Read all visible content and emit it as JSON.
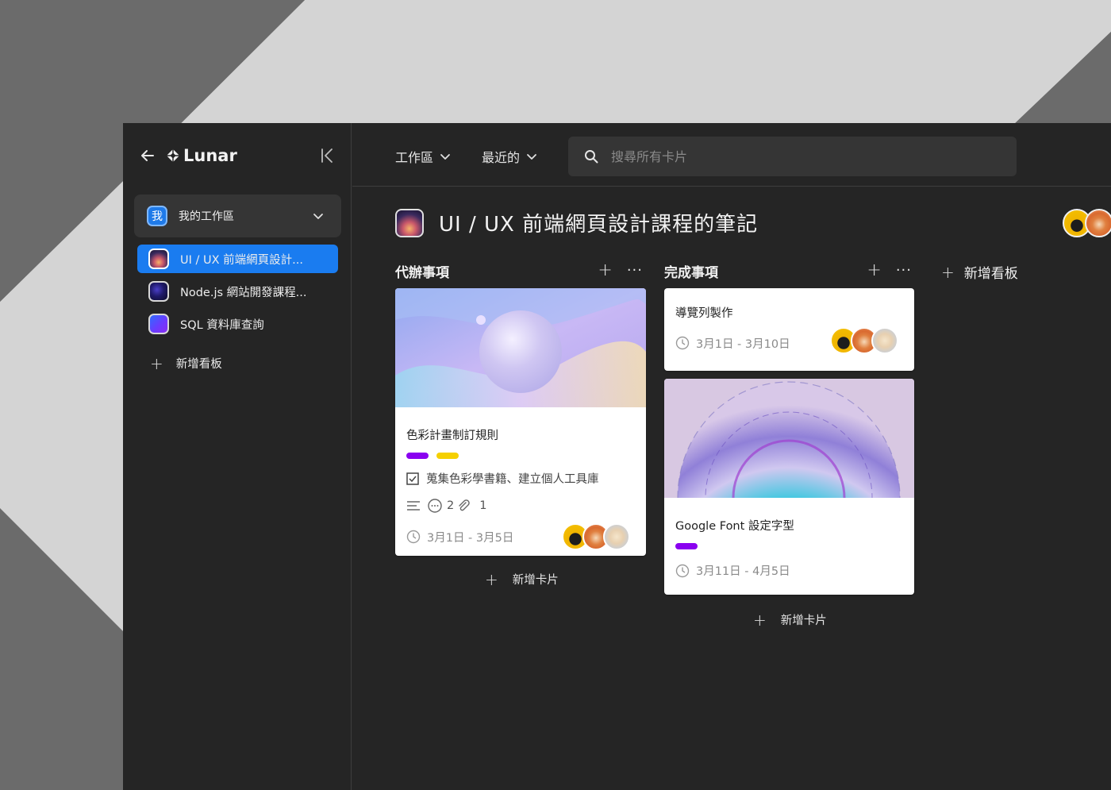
{
  "colors": {
    "accent": "#1a7cf0",
    "label_purple": "#8a00f0",
    "label_yellow": "#f5d000",
    "panel": "#252525"
  },
  "sidebar": {
    "logo": "Lunar",
    "workspace_badge": "我",
    "workspace_label": "我的工作區",
    "boards": [
      {
        "label": "UI / UX 前端網頁設計...",
        "active": true
      },
      {
        "label": "Node.js 網站開發課程...",
        "active": false
      },
      {
        "label": "SQL 資料庫查詢",
        "active": false
      }
    ],
    "add_board": "新增看板"
  },
  "topbar": {
    "workspace_menu": "工作區",
    "recent_menu": "最近的",
    "search_placeholder": "搜尋所有卡片"
  },
  "board": {
    "title": "UI / UX 前端網頁設計課程的筆記",
    "add_board": "新增看板",
    "columns": [
      {
        "title": "代辦事項",
        "add_card": "新增卡片",
        "cards": [
          {
            "title": "色彩計畫制訂規則",
            "checklist": "蒐集色彩學書籍、建立個人工具庫",
            "comments": "2",
            "attachments": "1",
            "date": "3月1日 - 3月5日"
          }
        ]
      },
      {
        "title": "完成事項",
        "add_card": "新增卡片",
        "cards": [
          {
            "title": "導覽列製作",
            "date": "3月1日 - 3月10日"
          },
          {
            "title": "Google Font 設定字型",
            "date": "3月11日 - 4月5日"
          }
        ]
      }
    ]
  }
}
